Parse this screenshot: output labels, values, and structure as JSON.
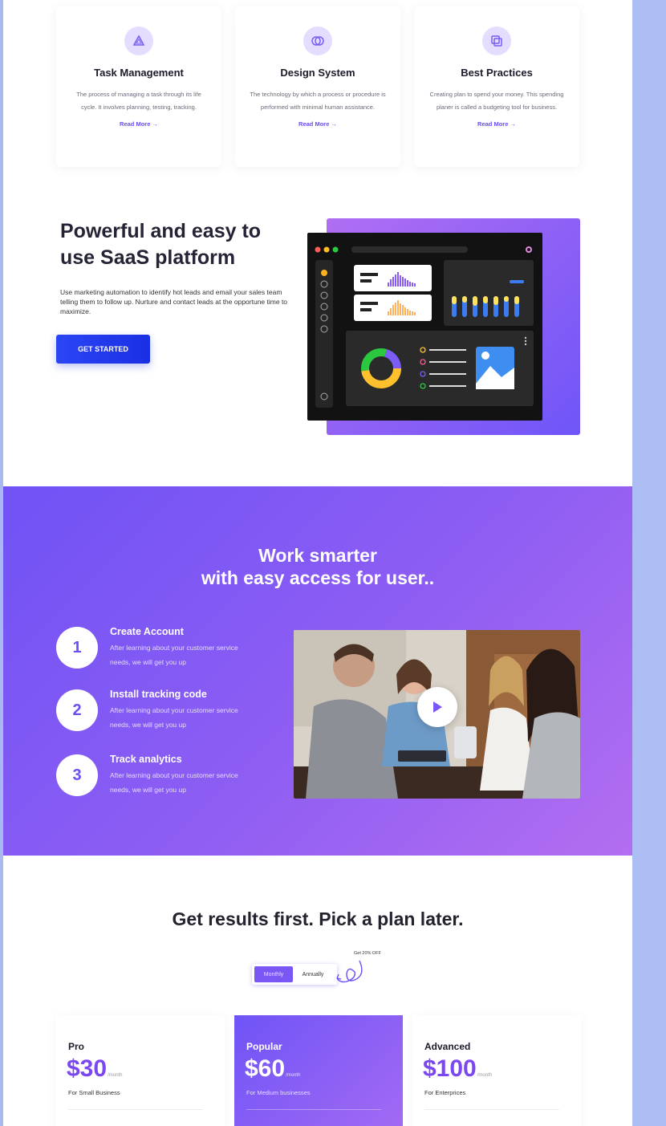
{
  "features": [
    {
      "icon": "triangle-icon",
      "title": "Task Management",
      "description": "The process of managing a task through its life cycle. It involves planning, testing, tracking.",
      "link": "Read More →"
    },
    {
      "icon": "rings-icon",
      "title": "Design System",
      "description": "The technology by which a process or procedure is performed with minimal human assistance.",
      "link": "Read More →"
    },
    {
      "icon": "layers-icon",
      "title": "Best Practices",
      "description": "Creating plan to spend your money. This spending planer is called a budgeting tool for business.",
      "link": "Read More →"
    }
  ],
  "hero": {
    "title": "Powerful and easy to use SaaS platform",
    "description": "Use marketing automation to identify hot leads and email your sales team telling them to follow up. Nurture and contact leads at the opportune time to maximize.",
    "button": "GET STARTED"
  },
  "steps_section": {
    "title_line1": "Work smarter",
    "title_line2": "with easy access for user..",
    "steps": [
      {
        "number": "1",
        "title": "Create Account",
        "description": "After learning about your customer service needs, we will get you up"
      },
      {
        "number": "2",
        "title": "Install tracking code",
        "description": "After learning about your customer service needs, we will get you up"
      },
      {
        "number": "3",
        "title": "Track analytics",
        "description": "After learning about your customer service needs, we will get you up"
      }
    ]
  },
  "pricing": {
    "title": "Get results first. Pick a plan later.",
    "toggle": {
      "monthly": "Monthly",
      "annually": "Annually",
      "selected": "Monthly"
    },
    "discount": "Get 20% OFF",
    "plans": [
      {
        "name": "Pro",
        "price": "$30",
        "unit": "/month",
        "for": "For Small Business"
      },
      {
        "name": "Popular",
        "price": "$60",
        "unit": "/month",
        "for": "For Medium businesses"
      },
      {
        "name": "Advanced",
        "price": "$100",
        "unit": "/month",
        "for": "For Enterprices"
      }
    ]
  },
  "colors": {
    "accent": "#6c4ff5",
    "button": "#2b45f5",
    "gradient_start": "#6f52f5",
    "gradient_end": "#b36ef0"
  }
}
